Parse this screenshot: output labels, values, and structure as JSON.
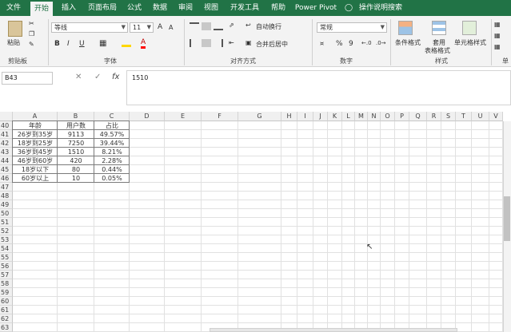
{
  "menu": {
    "tabs": [
      "文件",
      "开始",
      "插入",
      "页面布局",
      "公式",
      "数据",
      "审阅",
      "视图",
      "开发工具",
      "帮助",
      "Power Pivot"
    ],
    "tell_me": "操作说明搜索",
    "active_index": 1
  },
  "ribbon": {
    "clipboard": {
      "paste": "粘贴",
      "label": "剪贴板"
    },
    "font": {
      "name": "等线",
      "size": "11",
      "bold": "B",
      "italic": "I",
      "underline": "U",
      "grow": "A",
      "shrink": "A",
      "font_color": "A",
      "label": "字体"
    },
    "alignment": {
      "wrap": "自动换行",
      "merge": "合并后居中",
      "label": "对齐方式"
    },
    "number": {
      "format": "常规",
      "percent": "%",
      "comma": "9",
      "label": "数字"
    },
    "styles": {
      "conditional": "条件格式",
      "table_fmt_1": "套用",
      "table_fmt_2": "表格格式",
      "cell_styles": "单元格样式",
      "label": "样式"
    },
    "cells": {
      "label": "单"
    }
  },
  "formula_bar": {
    "name_box": "B43",
    "cancel": "✕",
    "enter": "✓",
    "fx": "fx",
    "value": "1510"
  },
  "sheet": {
    "columns": [
      "A",
      "B",
      "C",
      "D",
      "E",
      "F",
      "G",
      "H",
      "I",
      "J",
      "K",
      "L",
      "M",
      "N",
      "O",
      "P",
      "Q",
      "R",
      "S",
      "T",
      "U",
      "V"
    ],
    "rows": [
      "40",
      "41",
      "42",
      "43",
      "44",
      "45",
      "46",
      "47",
      "48",
      "49",
      "50",
      "51",
      "52",
      "53",
      "54",
      "55",
      "56",
      "57",
      "58",
      "59",
      "60",
      "61",
      "62",
      "63"
    ],
    "table": {
      "headers": [
        "年龄",
        "用户数",
        "占比"
      ],
      "rows": [
        [
          "26岁到35岁",
          "9113",
          "49.57%"
        ],
        [
          "18岁到25岁",
          "7250",
          "39.44%"
        ],
        [
          "36岁到45岁",
          "1510",
          "8.21%"
        ],
        [
          "46岁到60岁",
          "420",
          "2.28%"
        ],
        [
          "18岁以下",
          "80",
          "0.44%"
        ],
        [
          "60岁以上",
          "10",
          "0.05%"
        ]
      ]
    }
  }
}
